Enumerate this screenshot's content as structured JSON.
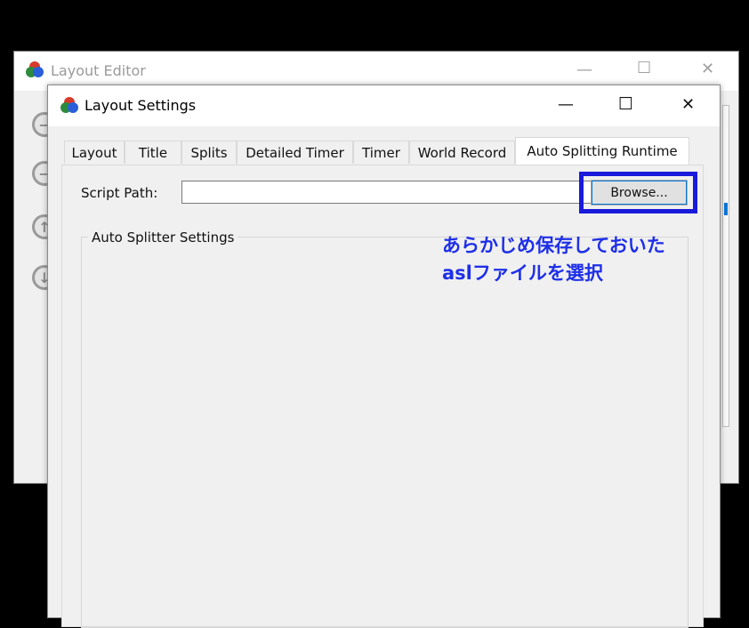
{
  "colors": {
    "accent_annotation": "#1e2fe8",
    "highlight_box": "#1a1adb",
    "window_bg": "#f0f0f0",
    "titlebar_bg": "#ffffff"
  },
  "background_window": {
    "title": "Layout Editor",
    "icon": "livesplit-logo-icon",
    "controls": {
      "minimize": "—",
      "maximize": "☐",
      "close": "✕"
    },
    "side_buttons": [
      "minus-circle-icon",
      "minus-circle-icon",
      "arrow-up-circle-icon",
      "arrow-down-circle-icon"
    ]
  },
  "settings_window": {
    "title": "Layout Settings",
    "icon": "livesplit-logo-icon",
    "controls": {
      "minimize": "—",
      "maximize": "☐",
      "close": "✕"
    },
    "tabs": [
      "Layout",
      "Title",
      "Splits",
      "Detailed Timer",
      "Timer",
      "World Record",
      "Auto Splitting Runtime"
    ],
    "active_tab": "Auto Splitting Runtime",
    "script_path": {
      "label": "Script Path:",
      "value": "",
      "browse_label": "Browse..."
    },
    "group_box_title": "Auto Splitter Settings"
  },
  "annotation": {
    "line1": "あらかじめ保存しておいた",
    "line2": "aslファイルを選択"
  }
}
